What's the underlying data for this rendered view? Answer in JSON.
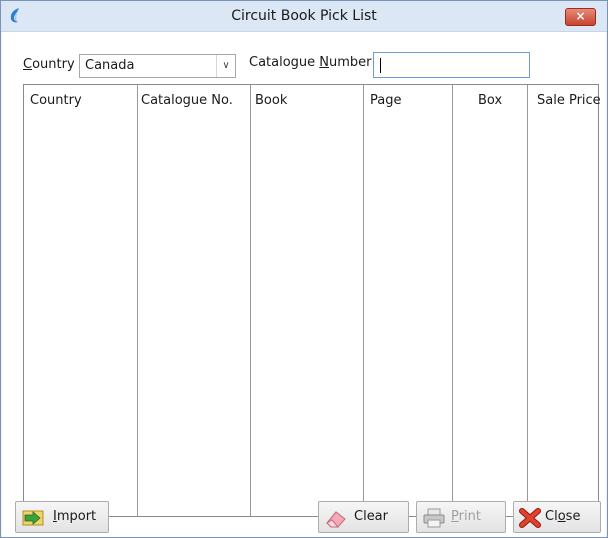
{
  "window": {
    "title": "Circuit Book Pick List",
    "close_glyph": "×"
  },
  "filters": {
    "country_label_accel": "C",
    "country_label_rest": "ountry",
    "country_value": "Canada",
    "catalogue_label_pre": "Catalogue ",
    "catalogue_label_accel": "N",
    "catalogue_label_rest": "umber",
    "catalogue_value": ""
  },
  "table": {
    "columns": [
      "Country",
      "Catalogue No.",
      "Book",
      "Page",
      "Box",
      "Sale Price"
    ],
    "rows": []
  },
  "buttons": {
    "import_accel": "I",
    "import_rest": "mport",
    "clear": "Clear",
    "print_accel": "P",
    "print_rest": "rint",
    "close_pre": "Cl",
    "close_accel": "o",
    "close_rest": "se"
  },
  "icons": {
    "app": "app-icon",
    "import": "import-arrow-icon",
    "clear": "eraser-icon",
    "print": "printer-icon",
    "close": "red-x-icon"
  },
  "colors": {
    "titlebar": "#dce7f5",
    "close_button": "#c7432f",
    "textbox_focus_border": "#6f9ad6"
  }
}
